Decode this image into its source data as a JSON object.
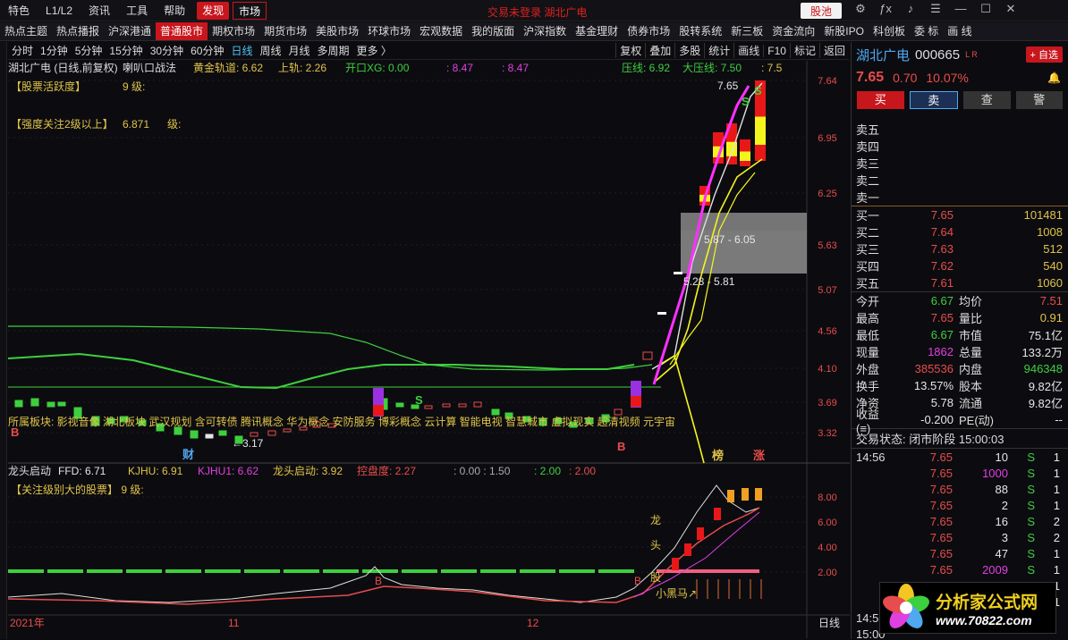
{
  "menu": [
    "特色",
    "L1/L2",
    "资讯",
    "工具",
    "帮助"
  ],
  "menu_tabs": [
    "发现",
    "市场"
  ],
  "window_title": "交易未登录  湖北广电",
  "gu_chi": "股池",
  "title_icons": [
    "gear-icon",
    "fx-icon",
    "sound-icon",
    "settings-icon",
    "minimize-icon",
    "maximize-icon",
    "close-icon"
  ],
  "nav": [
    "热点主题",
    "热点播报",
    "沪深港通",
    "普通股市",
    "期权市场",
    "期货市场",
    "美股市场",
    "环球市场",
    "宏观数据",
    "我的版面",
    "沪深指数",
    "基金理财",
    "债券市场",
    "股转系统",
    "新三板",
    "资金流向",
    "新股IPO",
    "科创板",
    "委 标",
    "画 线"
  ],
  "nav_active": 3,
  "periods": [
    "分时",
    "1分钟",
    "5分钟",
    "15分钟",
    "30分钟",
    "60分钟",
    "日线",
    "周线",
    "月线",
    "多周期",
    "更多 〉"
  ],
  "period_active": 6,
  "tools": [
    "复权",
    "叠加",
    "多股",
    "统计",
    "画线",
    "F10",
    "标记",
    "返回"
  ],
  "main": {
    "stock_label": "湖北广电 (日线,前复权)",
    "ind_name": "喇叭口战法",
    "ind_vals": [
      {
        "t": "黄金轨道: 6.62",
        "c": "#e0c34a"
      },
      {
        "t": "上轨: 2.26",
        "c": "#e0c34a"
      },
      {
        "t": "开口XG: 0.00",
        "c": "#3ecf3e"
      },
      {
        "t": ": 8.47",
        "c": "#e040e0"
      },
      {
        "t": ": 8.47",
        "c": "#e040e0"
      },
      {
        "t": "压线: 6.92",
        "c": "#3ecf3e"
      },
      {
        "t": "大压线: 7.50",
        "c": "#3ecf3e"
      },
      {
        "t": ": 7.5",
        "c": "#e0c34a"
      }
    ],
    "notes": [
      "【股票活跃度】",
      "9  级:",
      "【强度关注2级以上】",
      "6.871",
      "级:"
    ],
    "sectors": "所属板块:          影视音像 湖北板块 武汉规划 含可转债 腾讯概念 华为概念 安防服务 博彩概念 云计算 智能电视 智慧城市 虚拟现实 超清视频 元宇宙",
    "price_labels": [
      "7.65",
      "5.87 - 6.05",
      "5.28 - 5.81",
      "←3.17"
    ],
    "markers": [
      "B",
      "B",
      "财",
      "S",
      "S",
      "S",
      "榜",
      "涨"
    ],
    "y_axis": [
      "7.64",
      "6.95",
      "6.25",
      "5.63",
      "5.07",
      "4.56",
      "4.10",
      "3.69",
      "3.32"
    ]
  },
  "sub": {
    "label": "龙头启动",
    "vals": [
      {
        "t": "FFD: 6.71",
        "c": "#e6e6e6"
      },
      {
        "t": "KJHU: 6.91",
        "c": "#e0c34a"
      },
      {
        "t": "KJHU1: 6.62",
        "c": "#e040e0"
      },
      {
        "t": "龙头启动: 3.92",
        "c": "#e0c34a"
      },
      {
        "t": "控盘度: 2.27",
        "c": "#e84c4c"
      },
      {
        "t": ": 0.00 : 1.50",
        "c": "#aaa"
      },
      {
        "t": ": 2.00",
        "c": "#3ecf3e"
      },
      {
        "t": ": 2.00",
        "c": "#e84c4c"
      }
    ],
    "note": "【关注级别大的股票】  9  级:",
    "y_axis": [
      "8.00",
      "6.00",
      "4.00",
      "2.00"
    ],
    "words": [
      "龙",
      "头",
      "股",
      "小黑马↗",
      "B",
      "B"
    ]
  },
  "x_axis": [
    "2021年",
    "11",
    "12"
  ],
  "period_tag": "日线",
  "quote": {
    "name": "湖北广电",
    "code": "000665",
    "lr": "L R",
    "add_btn": "+ 自选",
    "price": "7.65",
    "change": "0.70",
    "pct": "10.07%",
    "actions": [
      "买",
      "卖",
      "查",
      "警"
    ],
    "asks": [
      "卖五",
      "卖四",
      "卖三",
      "卖二",
      "卖一"
    ],
    "bids": [
      {
        "l": "买一",
        "p": "7.65",
        "v": "101481"
      },
      {
        "l": "买二",
        "p": "7.64",
        "v": "1008"
      },
      {
        "l": "买三",
        "p": "7.63",
        "v": "512"
      },
      {
        "l": "买四",
        "p": "7.62",
        "v": "540"
      },
      {
        "l": "买五",
        "p": "7.61",
        "v": "1060"
      }
    ],
    "stats": [
      {
        "k1": "今开",
        "v1": "6.67",
        "c1": "g",
        "k2": "均价",
        "v2": "7.51",
        "c2": "r"
      },
      {
        "k1": "最高",
        "v1": "7.65",
        "c1": "r",
        "k2": "量比",
        "v2": "0.91",
        "c2": "y"
      },
      {
        "k1": "最低",
        "v1": "6.67",
        "c1": "g",
        "k2": "市值",
        "v2": "75.1亿",
        "c2": "w"
      },
      {
        "k1": "现量",
        "v1": "1862",
        "c1": "m",
        "k2": "总量",
        "v2": "133.2万",
        "c2": "w"
      },
      {
        "k1": "外盘",
        "v1": "385536",
        "c1": "r",
        "k2": "内盘",
        "v2": "946348",
        "c2": "g"
      },
      {
        "k1": "换手",
        "v1": "13.57%",
        "c1": "w",
        "k2": "股本",
        "v2": "9.82亿",
        "c2": "w"
      },
      {
        "k1": "净资",
        "v1": "5.78",
        "c1": "w",
        "k2": "流通",
        "v2": "9.82亿",
        "c2": "w"
      },
      {
        "k1": "收益(≡)",
        "v1": "-0.200",
        "c1": "w",
        "k2": "PE(动)",
        "v2": "--",
        "c2": "w"
      }
    ],
    "status": "交易状态: 闭市阶段 15:00:03",
    "ticks": [
      {
        "t": "14:56",
        "p": "7.65",
        "v": "10",
        "vc": "#e6e6e6",
        "s": "S",
        "n": "1"
      },
      {
        "t": "",
        "p": "7.65",
        "v": "1000",
        "vc": "#e040e0",
        "s": "S",
        "n": "1"
      },
      {
        "t": "",
        "p": "7.65",
        "v": "88",
        "vc": "#e6e6e6",
        "s": "S",
        "n": "1"
      },
      {
        "t": "",
        "p": "7.65",
        "v": "2",
        "vc": "#e6e6e6",
        "s": "S",
        "n": "1"
      },
      {
        "t": "",
        "p": "7.65",
        "v": "16",
        "vc": "#e6e6e6",
        "s": "S",
        "n": "2"
      },
      {
        "t": "",
        "p": "7.65",
        "v": "3",
        "vc": "#e6e6e6",
        "s": "S",
        "n": "2"
      },
      {
        "t": "",
        "p": "7.65",
        "v": "47",
        "vc": "#e6e6e6",
        "s": "S",
        "n": "1"
      },
      {
        "t": "",
        "p": "7.65",
        "v": "2009",
        "vc": "#e040e0",
        "s": "S",
        "n": "1"
      },
      {
        "t": "",
        "p": "7.65",
        "v": "1",
        "vc": "#e6e6e6",
        "s": "S",
        "n": "1"
      },
      {
        "t": "",
        "p": "7.65",
        "v": "",
        "vc": "#e6e6e6",
        "s": "S",
        "n": "1"
      },
      {
        "t": "14:5",
        "p": "",
        "v": "",
        "vc": "#e6e6e6",
        "s": "",
        "n": ""
      },
      {
        "t": "15:00",
        "p": "",
        "v": "",
        "vc": "#e6e6e6",
        "s": "",
        "n": ""
      }
    ]
  },
  "logo": {
    "title": "分析家公式网",
    "url": "www.70822.com"
  }
}
